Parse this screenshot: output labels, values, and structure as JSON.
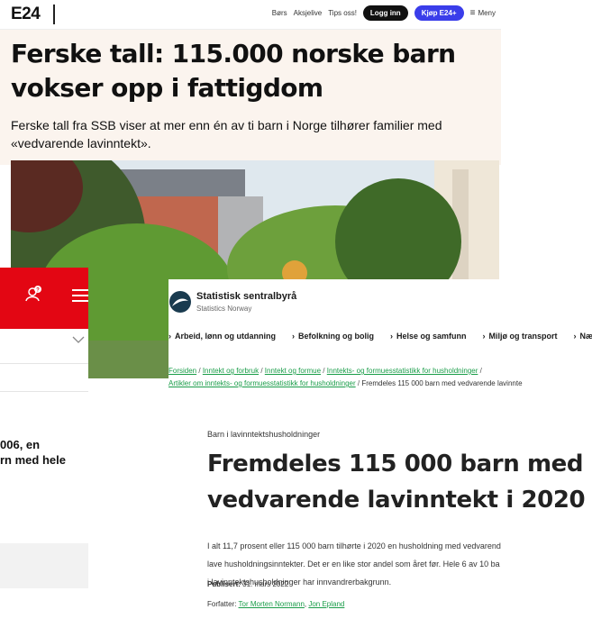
{
  "e24": {
    "logo": "E24",
    "links": [
      "Børs",
      "Aksjelive",
      "Tips oss!"
    ],
    "login_label": "Logg inn",
    "buy_label": "Kjøp E24+",
    "menu_label": "Meny",
    "title": "Ferske tall: 115.000 norske barn vokser opp i fattigdom",
    "lead": "Ferske tall fra SSB viser at mer enn én av ti barn i Norge tilhører familier med «vedvarende lavinntekt».",
    "colors": {
      "buy": "#3a3dea",
      "head_bg": "#fbf4ee"
    }
  },
  "mid": {
    "text_line1": "006, en",
    "text_line2": "rn med hele",
    "colors": {
      "bar": "#e30613"
    }
  },
  "ssb": {
    "name": "Statistisk sentralbyrå",
    "subname": "Statistics Norway",
    "nav": [
      "Arbeid, lønn og utdanning",
      "Befolkning og bolig",
      "Helse og samfunn",
      "Miljø og transport",
      "Næri"
    ],
    "breadcrumb": {
      "items": [
        "Forsiden",
        "Inntekt og forbruk",
        "Inntekt og formue",
        "Inntekts- og formuesstatistikk for husholdninger"
      ],
      "items2": [
        "Artikler om inntekts- og formuesstatistikk for husholdninger"
      ],
      "current": "Fremdeles 115 000 barn med vedvarende lavinnte"
    },
    "category": "Barn i lavinntektshusholdninger",
    "title": "Fremdeles 115 000 barn med vedvarende lavinntekt i 2020",
    "ingress_lines": [
      "I alt 11,7 prosent eller 115 000 barn tilhørte i 2020 en husholdning med vedvarend",
      "lave husholdningsinntekter. Det er en like stor andel som året før. Hele 6 av 10 ba",
      "i lavinntektshusholdninger har innvandrerbakgrunn."
    ],
    "published_label": "Publisert:",
    "published_date": "31. mars 2022",
    "author_label": "Forfatter:",
    "authors": [
      "Tor Morten Normann",
      "Jon Epland"
    ],
    "colors": {
      "link": "#1a9d49"
    }
  }
}
